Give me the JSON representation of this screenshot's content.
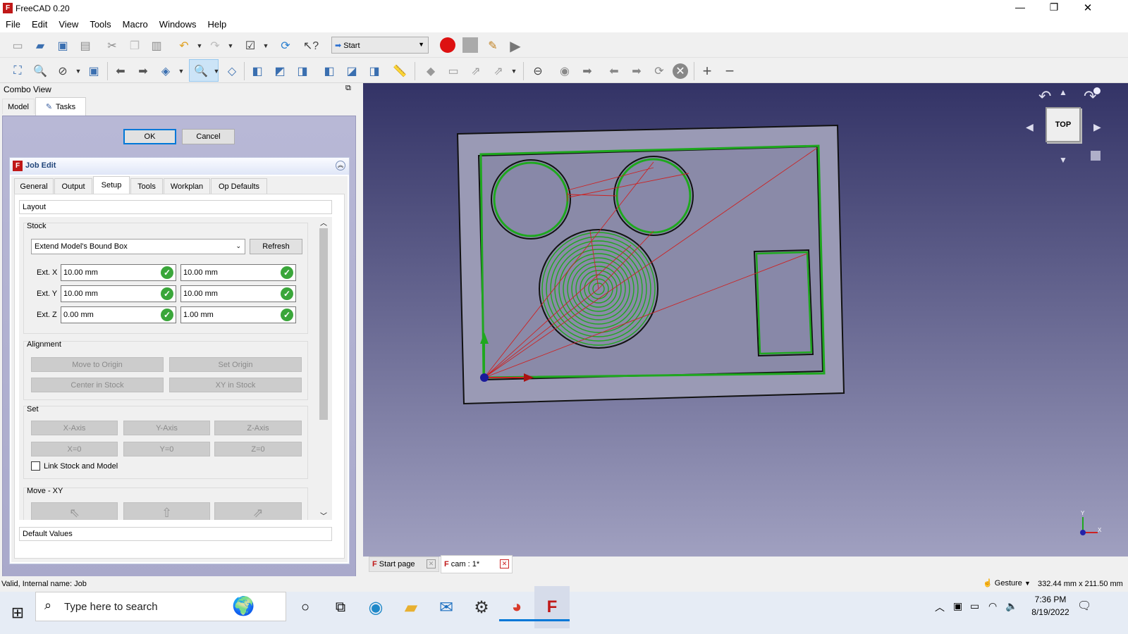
{
  "window": {
    "title": "FreeCAD 0.20",
    "controls": {
      "minimize": "—",
      "maximize": "❐",
      "close": "✕"
    }
  },
  "menu": [
    "File",
    "Edit",
    "View",
    "Tools",
    "Macro",
    "Windows",
    "Help"
  ],
  "toolbar": {
    "workbench": "Start"
  },
  "combo": {
    "title": "Combo View",
    "tabs": {
      "model": "Model",
      "tasks": "Tasks"
    },
    "ok": "OK",
    "cancel": "Cancel",
    "job_edit_title": "Job Edit",
    "job_tabs": [
      "General",
      "Output",
      "Setup",
      "Tools",
      "Workplan",
      "Op Defaults"
    ],
    "layout_label": "Layout",
    "default_values_label": "Default Values",
    "stock": {
      "group": "Stock",
      "mode": "Extend Model's Bound Box",
      "refresh": "Refresh",
      "ext_x_label": "Ext. X",
      "ext_x_neg": "10.00 mm",
      "ext_x_pos": "10.00 mm",
      "ext_y_label": "Ext. Y",
      "ext_y_neg": "10.00 mm",
      "ext_y_pos": "10.00 mm",
      "ext_z_label": "Ext. Z",
      "ext_z_neg": "0.00 mm",
      "ext_z_pos": "1.00 mm"
    },
    "alignment": {
      "group": "Alignment",
      "move_to_origin": "Move to Origin",
      "set_origin": "Set Origin",
      "center_in_stock": "Center in Stock",
      "xy_in_stock": "XY in Stock"
    },
    "set": {
      "group": "Set",
      "x_axis": "X-Axis",
      "y_axis": "Y-Axis",
      "z_axis": "Z-Axis",
      "x0": "X=0",
      "y0": "Y=0",
      "z0": "Z=0",
      "link": "Link Stock and Model"
    },
    "move_xy": {
      "group": "Move - XY"
    }
  },
  "viewport": {
    "navcube_face": "TOP",
    "axis_y": "Y",
    "axis_x": "X"
  },
  "doc_tabs": [
    "Start page",
    "cam : 1*"
  ],
  "status": {
    "left": "Valid, Internal name: Job",
    "nav_style": "Gesture",
    "dimensions": "332.44 mm x 211.50 mm"
  },
  "taskbar": {
    "search_placeholder": "Type here to search",
    "time": "7:36 PM",
    "date": "8/19/2022"
  },
  "colors": {
    "accent": "#0078d7",
    "toolpath_green": "#1fa81f",
    "rapid_red": "#cc2222",
    "record_red": "#dd1111"
  }
}
